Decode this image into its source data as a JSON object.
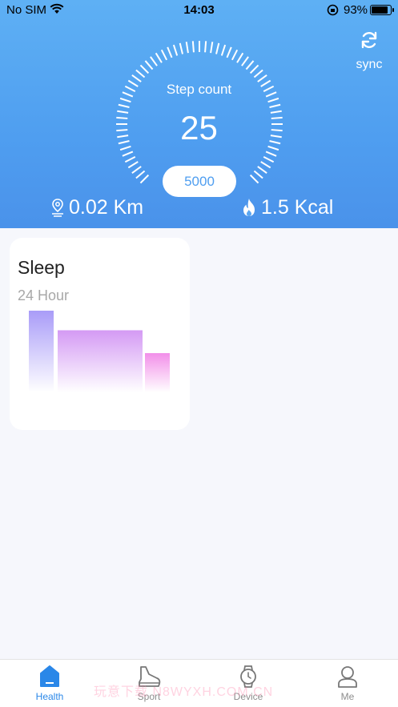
{
  "status_bar": {
    "carrier": "No SIM",
    "time": "14:03",
    "battery": "93%",
    "battery_level": 0.93
  },
  "header": {
    "sync_label": "sync",
    "step_label": "Step count",
    "step_count": "25",
    "goal": "5000",
    "distance": "0.02 Km",
    "calories": "1.5 Kcal",
    "icons": {
      "sync": "sync-icon",
      "distance": "location-pin-icon",
      "calories": "flame-icon"
    }
  },
  "sleep_card": {
    "title": "Sleep",
    "subtitle": "24 Hour",
    "bars": [
      {
        "level": 1.0,
        "color": "#a99cf8"
      },
      {
        "level": 0.76,
        "color": "#d49af4"
      },
      {
        "level": 0.48,
        "color": "#f28fe9"
      }
    ]
  },
  "tabs": [
    {
      "label": "Health",
      "icon": "home-icon",
      "active": true
    },
    {
      "label": "Sport",
      "icon": "shoe-icon",
      "active": false
    },
    {
      "label": "Device",
      "icon": "watch-icon",
      "active": false
    },
    {
      "label": "Me",
      "icon": "user-icon",
      "active": false
    }
  ],
  "watermark": "玩意下载 N8WYXH.COM.CN",
  "colors": {
    "accent": "#4f9ef0",
    "tab_active": "#2a87e8",
    "tab_inactive": "#8d8d8d"
  }
}
